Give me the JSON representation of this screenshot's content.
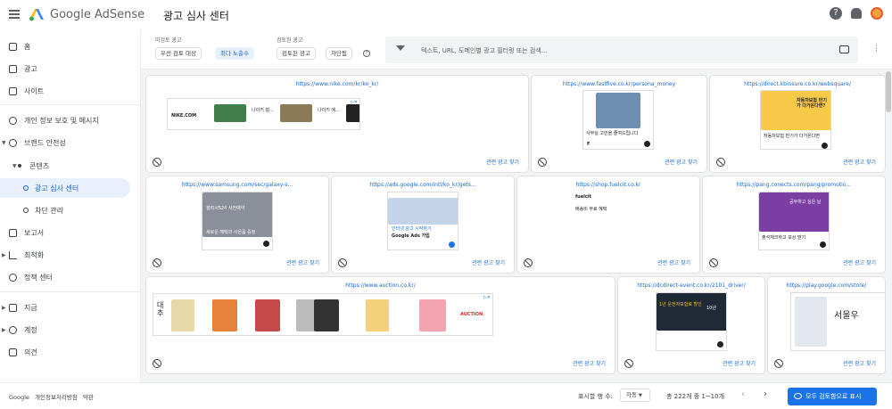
{
  "header": {
    "brand": "Google AdSense",
    "page_title": "광고 심사 센터",
    "help_glyph": "?"
  },
  "sidebar": {
    "items": [
      {
        "label": "홈",
        "icon": "home-icon"
      },
      {
        "label": "광고",
        "icon": "ads-icon"
      },
      {
        "label": "사이트",
        "icon": "sites-icon"
      },
      {
        "label": "개인 정보 보호 및 메시지",
        "icon": "privacy-icon"
      },
      {
        "label": "브랜드 안전성",
        "icon": "block-icon"
      },
      {
        "label": "콘텐츠",
        "icon": "dot"
      },
      {
        "label": "광고 심사 센터",
        "icon": "ring"
      },
      {
        "label": "차단 관리",
        "icon": "ring"
      },
      {
        "label": "보고서",
        "icon": "reports-icon"
      },
      {
        "label": "최적화",
        "icon": "trend-icon"
      },
      {
        "label": "정책 센터",
        "icon": "policy-icon"
      },
      {
        "label": "지급",
        "icon": "payments-icon"
      },
      {
        "label": "계정",
        "icon": "gear-icon"
      },
      {
        "label": "의견",
        "icon": "feedback-icon"
      }
    ]
  },
  "filters": {
    "unreviewed_label": "미검토 광고",
    "unreviewed_chips": [
      "우선 검토 대상",
      "최다 노출수"
    ],
    "reviewed_label": "검토된 광고",
    "reviewed_chips": [
      "검토된 광고",
      "차단됨"
    ],
    "info_glyph": "?",
    "search_placeholder": "텍스트, URL, 도메인별 광고 필터링 또는 검색..."
  },
  "cards": [
    {
      "url": "https://www.nike.com/kr/ko_kr/",
      "related": "관련 광고 찾기",
      "ad_text": [
        "나이키 덩...",
        "나이키 에..."
      ],
      "ad_brand": "NIKE.COM"
    },
    {
      "url": "https://www.fastfive.co.kr/persona_money",
      "related": "관련 광고 찾기",
      "ad_text": [
        "사무실 고민을 줄여드립니다",
        "F"
      ]
    },
    {
      "url": "https://direct.kbinsure.co.kr/websquare/",
      "related": "관련 광고 찾기",
      "ad_text": [
        "자동차보험 만기가 다가온다면?",
        "자동차보험 만기가 다가온다면"
      ]
    },
    {
      "url": "https://www.samsung.com/sec/galaxy-s...",
      "related": "관련 광고 찾기",
      "ad_text": [
        "갤럭시S24 사전예약",
        "새로운 혜택과 사은품 증정"
      ]
    },
    {
      "url": "https://ads.google.com/intl/ko_kr/gets...",
      "related": "관련 광고 찾기",
      "ad_text": [
        "인터넷 광고 시작하기",
        "Google Ads 가입"
      ]
    },
    {
      "url": "https://shop.fuelcit.co.kr",
      "related": "관련 광고 찾기",
      "ad_text": [
        "fuelcit",
        "배송비 무료 혜택"
      ]
    },
    {
      "url": "https://pang.conects.com/pang/promotio...",
      "related": "관련 광고 찾기",
      "ad_text": [
        "공부하고 싶은 날",
        "출석체크하고 보상 받기"
      ]
    },
    {
      "url": "https://www.auction.co.kr/",
      "related": "관련 광고 찾기",
      "ad_text": [
        "대추",
        "AUCTION."
      ]
    },
    {
      "url": "https://dcdirect-event.co.kr/2101_driver/",
      "related": "관련 광고 찾기",
      "ad_text": [
        "1년 운전자보험료 할인",
        "10년"
      ]
    },
    {
      "url": "https://play.google.com/store/",
      "related": "관련 광고 찾기",
      "ad_text": [
        "서울우"
      ]
    }
  ],
  "footer": {
    "links": [
      "Google",
      "개인정보처리방침",
      "약관"
    ],
    "per_page_label": "표시할 행 수:",
    "per_page_value": "자동",
    "range_text": "총 222개 중 1~10개",
    "prev_glyph": "‹",
    "next_glyph": "›",
    "review_all_label": "모두 검토함으로 표시"
  },
  "colors": {
    "accent": "#1a73e8",
    "link": "#1967d2",
    "active_bg": "#e8f0fe"
  }
}
